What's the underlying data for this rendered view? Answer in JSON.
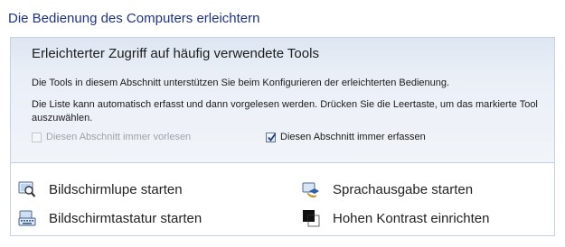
{
  "page_title": "Die Bedienung des Computers erleichtern",
  "section": {
    "heading": "Erleichterter Zugriff auf häufig verwendete Tools",
    "description_1": "Die Tools in diesem Abschnitt unterstützen Sie beim Konfigurieren der erleichterten Bedienung.",
    "description_2": "Die Liste kann automatisch erfasst und dann vorgelesen werden. Drücken Sie die Leertaste, um das markierte Tool auszuwählen.",
    "checkbox_read": {
      "label": "Diesen Abschnitt immer vorlesen",
      "checked": false,
      "enabled": false
    },
    "checkbox_scan": {
      "label": "Diesen Abschnitt immer erfassen",
      "checked": true,
      "enabled": true
    }
  },
  "tools": {
    "magnifier": {
      "label": "Bildschirmlupe starten",
      "icon": "magnifier-icon"
    },
    "onscreen_keyboard": {
      "label": "Bildschirmtastatur starten",
      "icon": "keyboard-icon"
    },
    "narrator": {
      "label": "Sprachausgabe starten",
      "icon": "narrator-icon"
    },
    "high_contrast": {
      "label": "Hohen Kontrast einrichten",
      "icon": "high-contrast-icon"
    }
  },
  "colors": {
    "title": "#1e3287",
    "section_border": "#c6d2e3",
    "section_band": "#e6edf6"
  }
}
